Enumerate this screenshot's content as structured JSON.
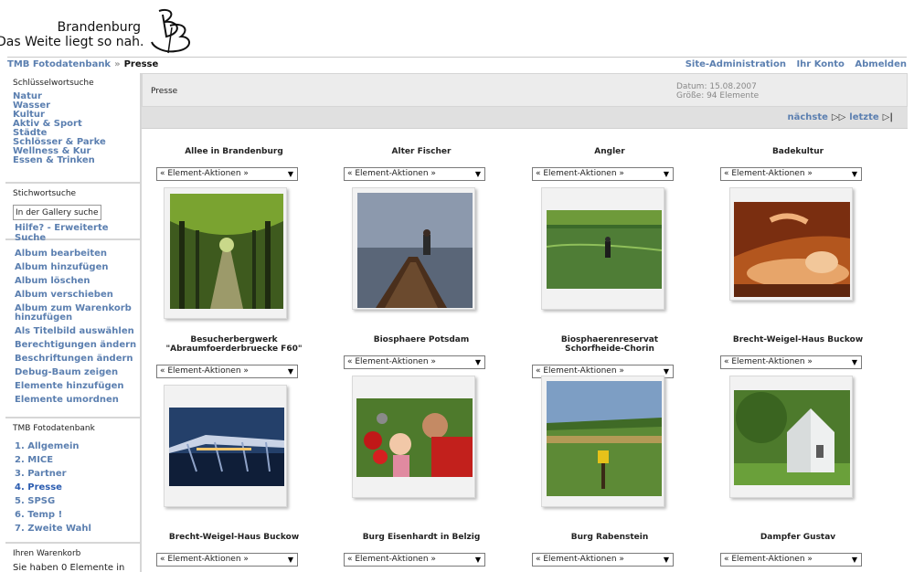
{
  "brand": {
    "line1": "Brandenburg",
    "line2": "Das Weite liegt so nah."
  },
  "breadcrumb": {
    "root": "TMB Fotodatenbank",
    "sep": "»",
    "current": "Presse"
  },
  "toplinks": [
    "Site-Administration",
    "Ihr Konto",
    "Abmelden"
  ],
  "sidebar": {
    "keyword_title": "Schlüsselwortsuche",
    "keywords": [
      "Natur",
      "Wasser",
      "Kultur",
      "Aktiv & Sport",
      "Städte",
      "Schlösser & Parke",
      "Wellness & Kur",
      "Essen & Trinken"
    ],
    "search_title": "Stichwortsuche",
    "search_value": "In der Gallery suchen",
    "search_help": "Hilfe? - Erweiterte Suche",
    "actions": [
      "Album bearbeiten",
      "Album hinzufügen",
      "Album löschen",
      "Album verschieben",
      "Album zum Warenkorb hinzufügen",
      "Als Titelbild auswählen",
      "Berechtigungen ändern",
      "Beschriftungen ändern",
      "Debug-Baum zeigen",
      "Elemente hinzufügen",
      "Elemente umordnen"
    ],
    "albums_title": "TMB Fotodatenbank",
    "albums": [
      "1. Allgemein",
      "2. MICE",
      "3. Partner",
      "4. Presse",
      "5. SPSG",
      "6. Temp !",
      "7. Zweite Wahl"
    ],
    "cart_title": "Ihren Warenkorb",
    "cart_text": "Sie haben 0 Elemente in"
  },
  "header": {
    "title": "Presse",
    "date": "Datum: 15.08.2007",
    "size": "Größe: 94 Elemente"
  },
  "nav": {
    "next": "nächste",
    "last": "letzte"
  },
  "select_label": "« Element-Aktionen »",
  "items": [
    {
      "title": "Allee in Brandenburg"
    },
    {
      "title": "Alter Fischer"
    },
    {
      "title": "Angler"
    },
    {
      "title": "Badekultur"
    },
    {
      "title": "Besucherbergwerk \"Abraumfoerderbruecke F60\""
    },
    {
      "title": "Biosphaere Potsdam"
    },
    {
      "title": "Biosphaerenreservat Schorfheide-Chorin"
    },
    {
      "title": "Brecht-Weigel-Haus Buckow"
    },
    {
      "title": "Brecht-Weigel-Haus Buckow"
    },
    {
      "title": "Burg Eisenhardt in Belzig"
    },
    {
      "title": "Burg Rabenstein"
    },
    {
      "title": "Dampfer Gustav"
    }
  ],
  "colors": {
    "link": "#5b7fb0",
    "header_bg": "#ececec",
    "nav_bg": "#e0e0e0"
  }
}
